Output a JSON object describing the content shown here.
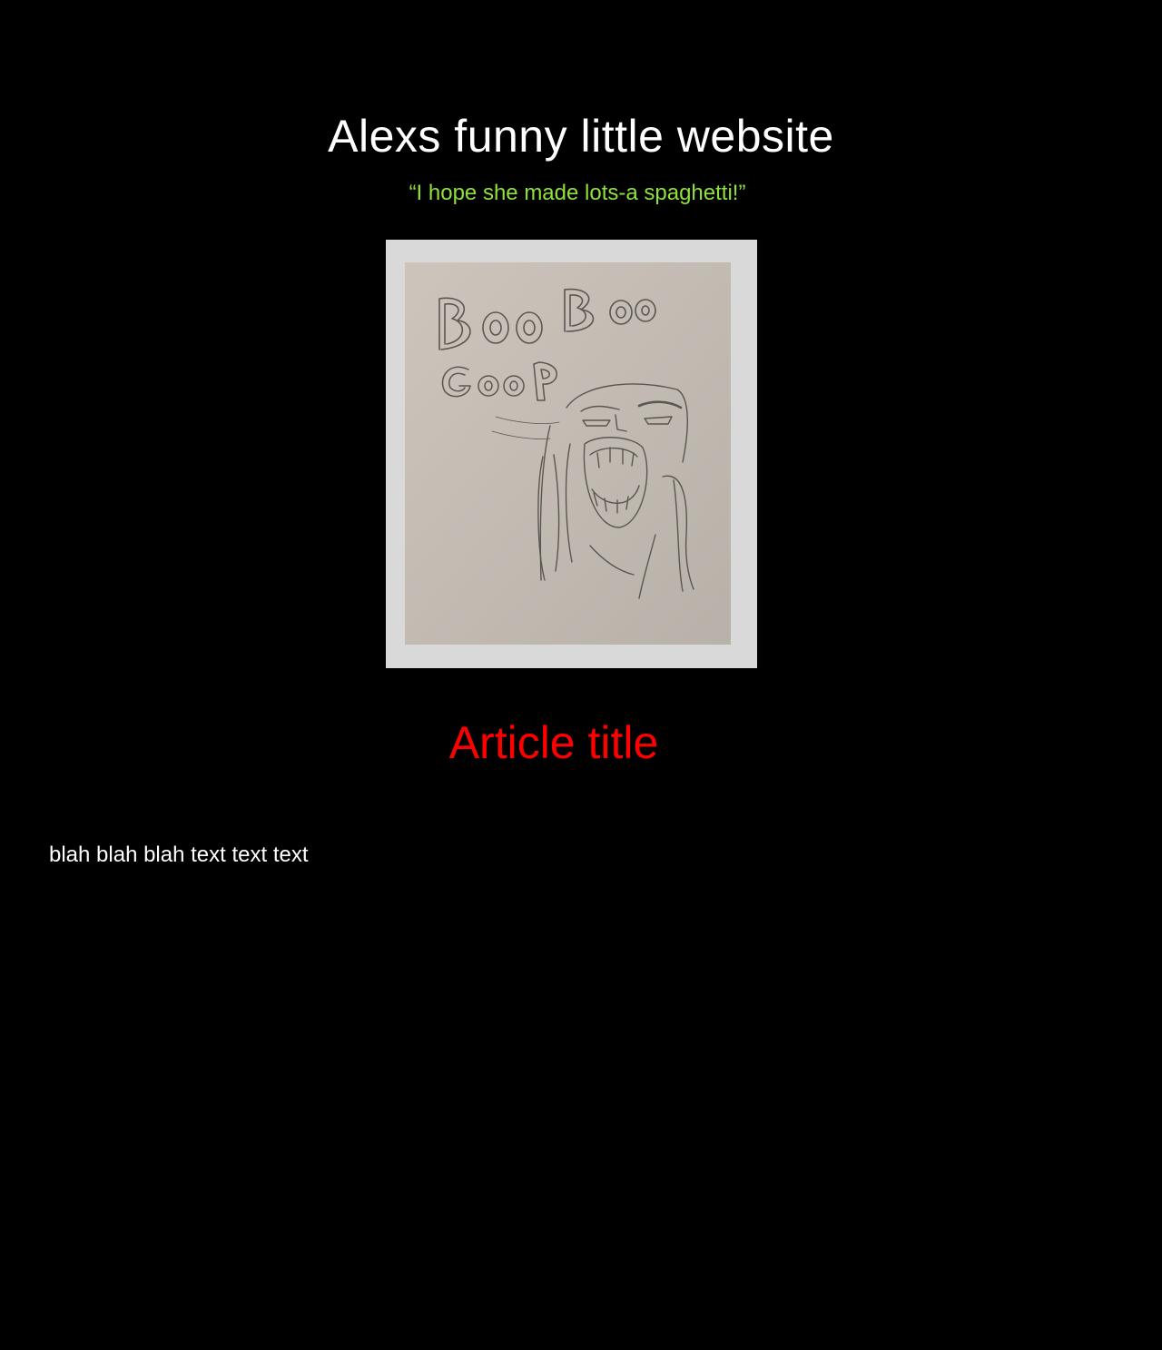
{
  "header": {
    "site_title": "Alexs funny little website",
    "tagline": "“I hope she made lots-a spaghetti!”"
  },
  "hero_image": {
    "drawn_lettering": [
      "Boo Boo",
      "Goop"
    ],
    "subject": "pencil-drawing-screaming-face"
  },
  "article": {
    "title": "Article title",
    "body": "blah blah blah text text text"
  },
  "colors": {
    "background": "#000000",
    "title_text": "#ffffff",
    "tagline_text": "#8fe23a",
    "article_title_text": "#ff0000",
    "body_text": "#ffffff",
    "frame": "#d9d9d9",
    "paper": "#c6bfb7"
  }
}
